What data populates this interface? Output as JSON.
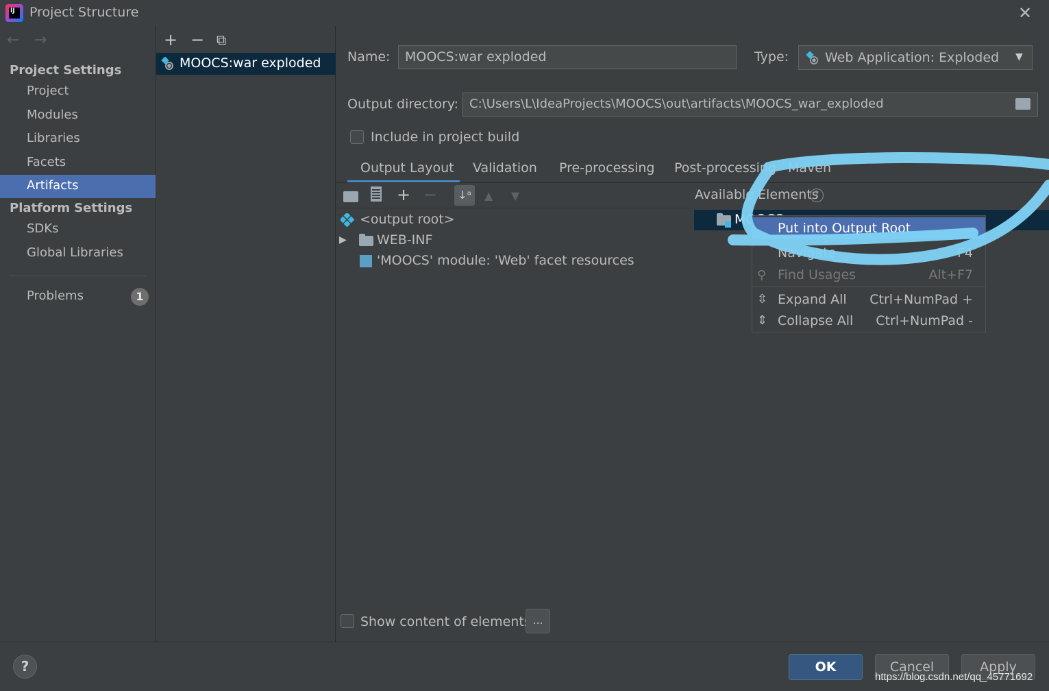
{
  "window": {
    "title": "Project Structure",
    "logo_text": "IJ"
  },
  "sidebar": {
    "project_settings_title": "Project Settings",
    "project_items": [
      {
        "label": "Project"
      },
      {
        "label": "Modules"
      },
      {
        "label": "Libraries"
      },
      {
        "label": "Facets"
      },
      {
        "label": "Artifacts",
        "selected": true
      }
    ],
    "platform_settings_title": "Platform Settings",
    "platform_items": [
      {
        "label": "SDKs"
      },
      {
        "label": "Global Libraries"
      }
    ],
    "problems_label": "Problems",
    "problems_count": "1"
  },
  "artifacts": {
    "items": [
      {
        "label": "MOOCS:war exploded",
        "selected": true
      }
    ]
  },
  "form": {
    "name_label": "Name:",
    "name_value": "MOOCS:war exploded",
    "type_label": "Type:",
    "type_value": "Web Application: Exploded",
    "output_dir_label": "Output directory:",
    "output_dir_value": "C:\\Users\\L\\IdeaProjects\\MOOCS\\out\\artifacts\\MOOCS_war_exploded",
    "include_build_label": "Include in project build",
    "include_build_checked": false
  },
  "tabs": [
    {
      "label": "Output Layout",
      "active": true
    },
    {
      "label": "Validation"
    },
    {
      "label": "Pre-processing"
    },
    {
      "label": "Post-processing"
    },
    {
      "label": "Maven"
    }
  ],
  "layout_tree": [
    {
      "label": "<output root>"
    },
    {
      "label": "WEB-INF"
    },
    {
      "label": "'MOOCS' module: 'Web' facet resources"
    }
  ],
  "available": {
    "title": "Available Elements",
    "selected_item": "MOOCS"
  },
  "context_menu": {
    "items": [
      {
        "label": "Put into Output Root",
        "shortcut": "",
        "highlighted": true
      },
      {
        "label": "Navigate",
        "shortcut": "F4"
      },
      {
        "label": "Find Usages",
        "shortcut": "Alt+F7",
        "disabled": true
      },
      {
        "label": "Expand All",
        "shortcut": "Ctrl+NumPad +"
      },
      {
        "label": "Collapse All",
        "shortcut": "Ctrl+NumPad -"
      }
    ]
  },
  "bottom": {
    "show_content_label": "Show content of elements",
    "dots_label": "...",
    "help_label": "?",
    "ok_label": "OK",
    "cancel_label": "Cancel",
    "apply_label": "Apply",
    "watermark": "https://blog.csdn.net/qq_45771692"
  },
  "colors": {
    "background": "#3c3f41",
    "selection": "#4b6eaf",
    "tree_selection": "#0d293e",
    "scribble": "#7fd3f7"
  }
}
